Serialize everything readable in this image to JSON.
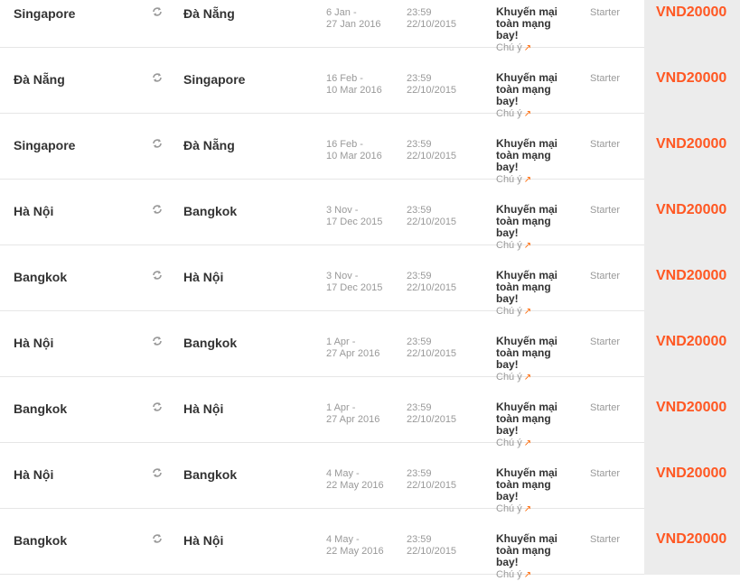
{
  "colors": {
    "price": "#ff5722",
    "arrow": "#ff6600",
    "price_bg": "#ececec"
  },
  "icons": {
    "swap": "swap-arrows-icon",
    "note_arrow": "external-arrow-icon"
  },
  "rows": [
    {
      "from": "Singapore",
      "to": "Đà Nẵng",
      "travel_start": "6 Jan -",
      "travel_end": "27 Jan 2016",
      "deadline_time": "23:59",
      "deadline_date": "22/10/2015",
      "promo": "Khuyến mại toàn mạng bay!",
      "note": "Chú ý",
      "fare": "Starter",
      "price": "VND20000"
    },
    {
      "from": "Đà Nẵng",
      "to": "Singapore",
      "travel_start": "16 Feb -",
      "travel_end": "10 Mar 2016",
      "deadline_time": "23:59",
      "deadline_date": "22/10/2015",
      "promo": "Khuyến mại toàn mạng bay!",
      "note": "Chú ý",
      "fare": "Starter",
      "price": "VND20000"
    },
    {
      "from": "Singapore",
      "to": "Đà Nẵng",
      "travel_start": "16 Feb -",
      "travel_end": "10 Mar 2016",
      "deadline_time": "23:59",
      "deadline_date": "22/10/2015",
      "promo": "Khuyến mại toàn mạng bay!",
      "note": "Chú ý",
      "fare": "Starter",
      "price": "VND20000"
    },
    {
      "from": "Hà Nội",
      "to": "Bangkok",
      "travel_start": "3 Nov -",
      "travel_end": "17 Dec 2015",
      "deadline_time": "23:59",
      "deadline_date": "22/10/2015",
      "promo": "Khuyến mại toàn mạng bay!",
      "note": "Chú ý",
      "fare": "Starter",
      "price": "VND20000"
    },
    {
      "from": "Bangkok",
      "to": "Hà Nội",
      "travel_start": "3 Nov -",
      "travel_end": "17 Dec 2015",
      "deadline_time": "23:59",
      "deadline_date": "22/10/2015",
      "promo": "Khuyến mại toàn mạng bay!",
      "note": "Chú ý",
      "fare": "Starter",
      "price": "VND20000"
    },
    {
      "from": "Hà Nội",
      "to": "Bangkok",
      "travel_start": "1 Apr -",
      "travel_end": "27 Apr 2016",
      "deadline_time": "23:59",
      "deadline_date": "22/10/2015",
      "promo": "Khuyến mại toàn mạng bay!",
      "note": "Chú ý",
      "fare": "Starter",
      "price": "VND20000"
    },
    {
      "from": "Bangkok",
      "to": "Hà Nội",
      "travel_start": "1 Apr -",
      "travel_end": "27 Apr 2016",
      "deadline_time": "23:59",
      "deadline_date": "22/10/2015",
      "promo": "Khuyến mại toàn mạng bay!",
      "note": "Chú ý",
      "fare": "Starter",
      "price": "VND20000"
    },
    {
      "from": "Hà Nội",
      "to": "Bangkok",
      "travel_start": "4 May -",
      "travel_end": "22 May 2016",
      "deadline_time": "23:59",
      "deadline_date": "22/10/2015",
      "promo": "Khuyến mại toàn mạng bay!",
      "note": "Chú ý",
      "fare": "Starter",
      "price": "VND20000"
    },
    {
      "from": "Bangkok",
      "to": "Hà Nội",
      "travel_start": "4 May -",
      "travel_end": "22 May 2016",
      "deadline_time": "23:59",
      "deadline_date": "22/10/2015",
      "promo": "Khuyến mại toàn mạng bay!",
      "note": "Chú ý",
      "fare": "Starter",
      "price": "VND20000"
    }
  ]
}
